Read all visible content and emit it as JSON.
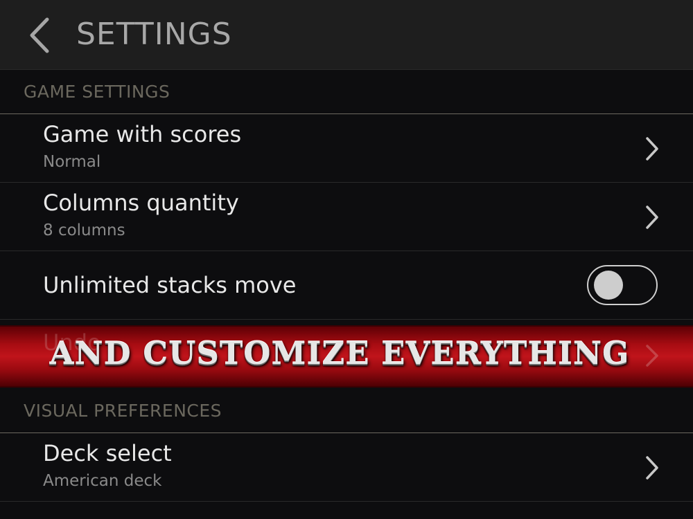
{
  "header": {
    "title": "SETTINGS",
    "back_icon": "chevron-left-icon"
  },
  "game_settings": {
    "header": "GAME SETTINGS",
    "items": [
      {
        "title": "Game with scores",
        "value": "Normal",
        "icon": "chevron-right-icon"
      },
      {
        "title": "Columns quantity",
        "value": "8 columns",
        "icon": "chevron-right-icon"
      },
      {
        "title": "Unlimited stacks move",
        "toggle": "off"
      },
      {
        "title": "Undo",
        "icon": "chevron-right-icon"
      }
    ]
  },
  "banner": {
    "text": "AND CUSTOMIZE EVERYTHING"
  },
  "visual_preferences": {
    "header": "VISUAL PREFERENCES",
    "items": [
      {
        "title": "Deck select",
        "value": "American deck",
        "icon": "chevron-right-icon"
      }
    ]
  },
  "colors": {
    "background": "#0d0d0f",
    "top_bar": "#1e1e1e",
    "banner_red": "#c0141b",
    "section_header_text": "#6b685e"
  }
}
